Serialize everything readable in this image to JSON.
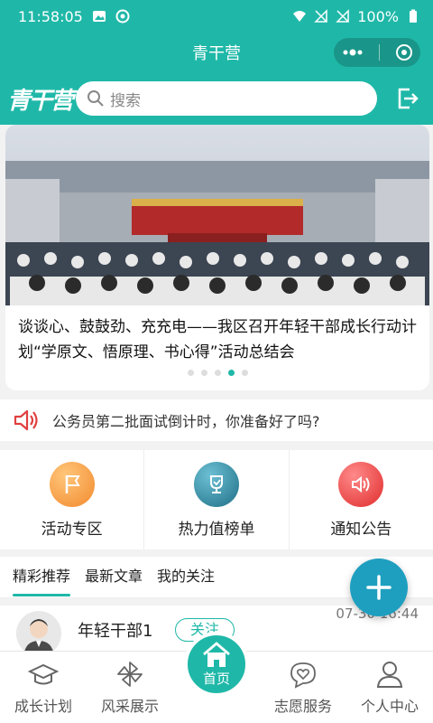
{
  "status_bar": {
    "time": "11:58:05",
    "battery": "100%"
  },
  "header": {
    "title": "青干营"
  },
  "search": {
    "logo": "青干营",
    "placeholder": "搜索"
  },
  "banner": {
    "title": "谈谈心、鼓鼓劲、充充电——我区召开年轻干部成长行动计划“学原文、悟原理、书心得”活动总结会",
    "dots_count": 5,
    "active_dot": 3
  },
  "notice": {
    "text": "公务员第二批面试倒计时，你准备好了吗?"
  },
  "features": [
    {
      "label": "活动专区",
      "icon": "flag-icon",
      "color": "#f7a040"
    },
    {
      "label": "热力值榜单",
      "icon": "trophy-icon",
      "color": "#2b8fa6"
    },
    {
      "label": "通知公告",
      "icon": "speaker-icon",
      "color": "#f04848"
    }
  ],
  "tabs": [
    {
      "label": "精彩推荐",
      "active": true
    },
    {
      "label": "最新文章",
      "active": false
    },
    {
      "label": "我的关注",
      "active": false
    }
  ],
  "article": {
    "author": "年轻干部1",
    "follow_label": "关注",
    "time": "07-30 16:44"
  },
  "bottom_nav": [
    {
      "label": "成长计划",
      "icon": "graduation-cap-icon"
    },
    {
      "label": "风采展示",
      "icon": "pinwheel-icon"
    },
    {
      "label": "首页",
      "icon": "home-icon"
    },
    {
      "label": "志愿服务",
      "icon": "heart-chat-icon"
    },
    {
      "label": "个人中心",
      "icon": "person-icon"
    }
  ],
  "colors": {
    "primary": "#1fb8a8",
    "fab": "#1e9fc0",
    "notice_icon": "#e04040"
  }
}
